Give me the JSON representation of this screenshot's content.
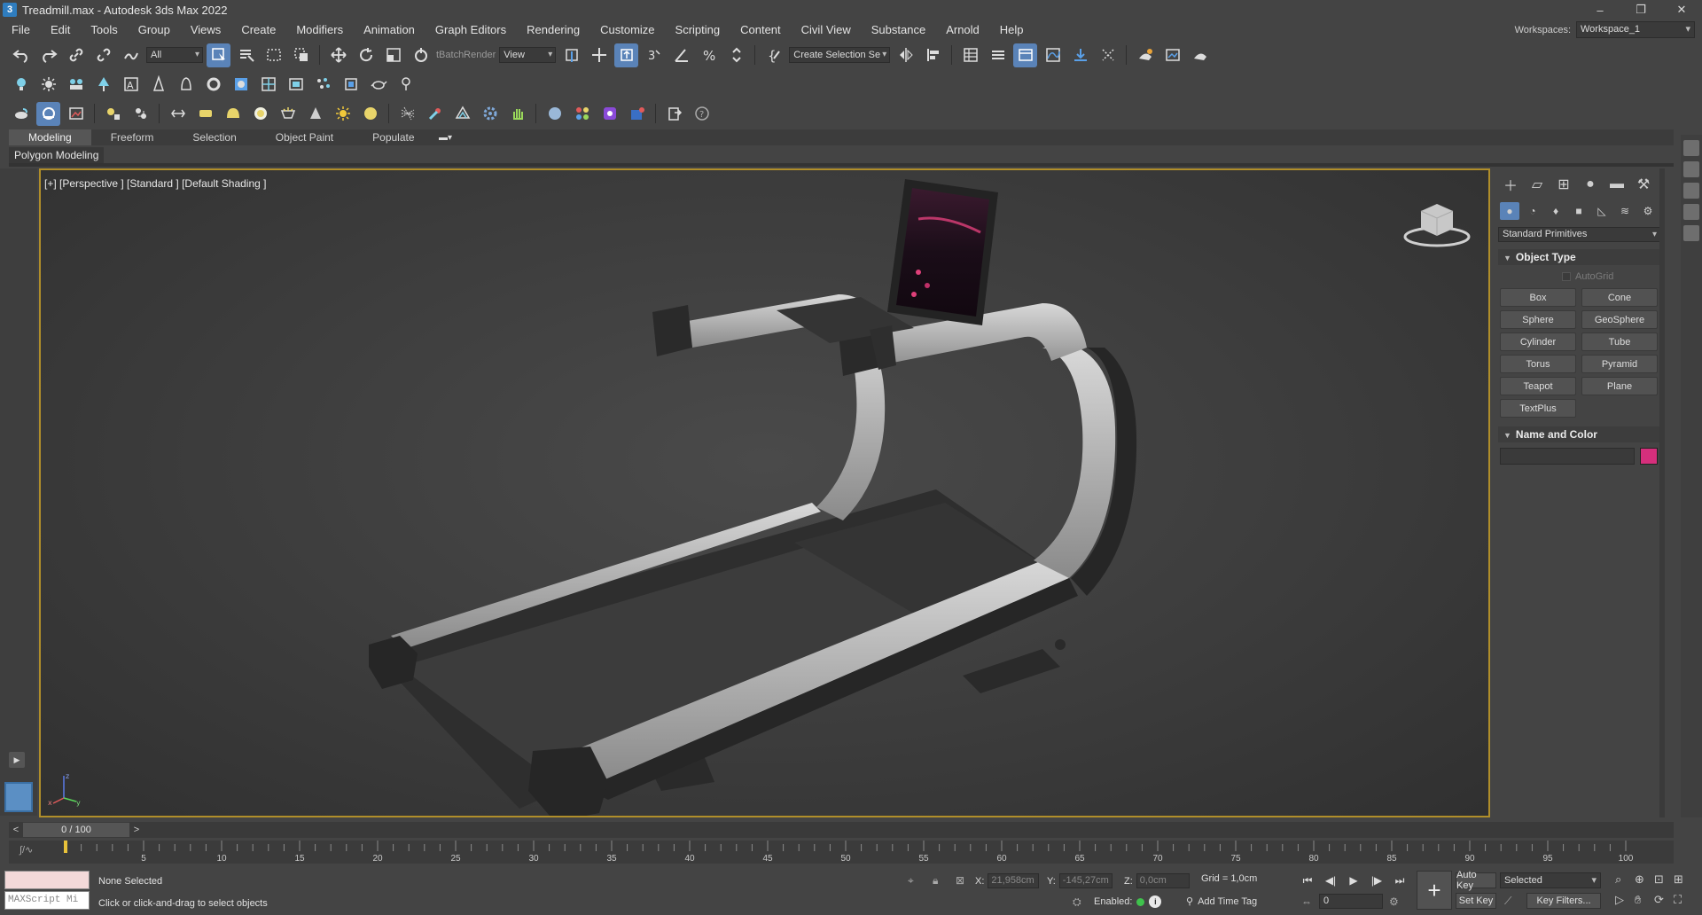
{
  "window": {
    "title": "Treadmill.max - Autodesk 3ds Max 2022",
    "app_icon": "3",
    "controls": [
      "–",
      "❐",
      "✕"
    ]
  },
  "menu": [
    "File",
    "Edit",
    "Tools",
    "Group",
    "Views",
    "Create",
    "Modifiers",
    "Animation",
    "Graph Editors",
    "Rendering",
    "Customize",
    "Scripting",
    "Content",
    "Civil View",
    "Substance",
    "Arnold",
    "Help"
  ],
  "workspace": {
    "label": "Workspaces:",
    "value": "Workspace_1"
  },
  "toolbar": {
    "filter_value": "All",
    "batch_render_label": "tBatchRender",
    "view_value": "View",
    "selection_set_value": "Create Selection Se"
  },
  "ribbon": {
    "tabs": [
      "Modeling",
      "Freeform",
      "Selection",
      "Object Paint",
      "Populate"
    ],
    "active_tab": "Modeling",
    "sub_panel": "Polygon Modeling"
  },
  "viewport": {
    "label": "[+] [Perspective ] [Standard ] [Default Shading ]",
    "axis": {
      "z": "z",
      "x": "x",
      "y": "y"
    }
  },
  "command_panel": {
    "category": "Standard Primitives",
    "object_type_title": "Object Type",
    "autogrid_label": "AutoGrid",
    "primitives": [
      "Box",
      "Cone",
      "Sphere",
      "GeoSphere",
      "Cylinder",
      "Tube",
      "Torus",
      "Pyramid",
      "Teapot",
      "Plane",
      "TextPlus"
    ],
    "name_color_title": "Name and Color",
    "object_color": "#d62f7c"
  },
  "timeline": {
    "frame_display": "0 / 100",
    "prev": "<",
    "next": ">",
    "ticks": [
      "5",
      "10",
      "15",
      "20",
      "25",
      "30",
      "35",
      "40",
      "45",
      "50",
      "55",
      "60",
      "65",
      "70",
      "75",
      "80",
      "85",
      "90",
      "95",
      "100"
    ]
  },
  "status": {
    "selection": "None Selected",
    "prompt": "Click or click-and-drag to select objects",
    "maxscript_placeholder": "MAXScript Mi",
    "x_label": "X:",
    "x_value": "21,958cm",
    "y_label": "Y:",
    "y_value": "-145,27cm",
    "z_label": "Z:",
    "z_value": "0,0cm",
    "grid": "Grid = 1,0cm",
    "enabled_label": "Enabled:",
    "add_time_tag": "Add Time Tag",
    "current_frame": "0",
    "auto_key": "Auto Key",
    "set_key": "Set Key",
    "key_mode": "Selected",
    "key_filters": "Key Filters..."
  }
}
